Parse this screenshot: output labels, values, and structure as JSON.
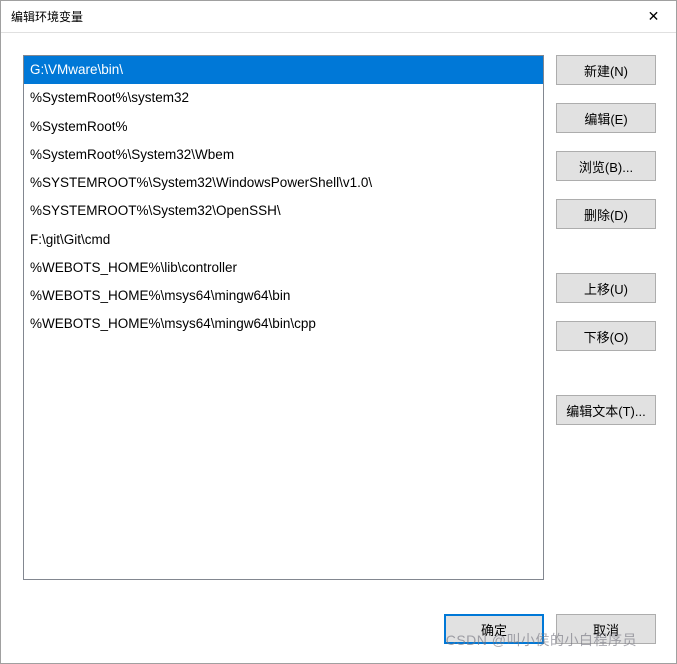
{
  "window": {
    "title": "编辑环境变量",
    "close": "✕"
  },
  "list": {
    "items": [
      "G:\\VMware\\bin\\",
      "%SystemRoot%\\system32",
      "%SystemRoot%",
      "%SystemRoot%\\System32\\Wbem",
      "%SYSTEMROOT%\\System32\\WindowsPowerShell\\v1.0\\",
      "%SYSTEMROOT%\\System32\\OpenSSH\\",
      "F:\\git\\Git\\cmd",
      "%WEBOTS_HOME%\\lib\\controller",
      "%WEBOTS_HOME%\\msys64\\mingw64\\bin",
      "%WEBOTS_HOME%\\msys64\\mingw64\\bin\\cpp"
    ],
    "selected_index": 0
  },
  "buttons": {
    "new": "新建(N)",
    "edit": "编辑(E)",
    "browse": "浏览(B)...",
    "delete": "删除(D)",
    "move_up": "上移(U)",
    "move_down": "下移(O)",
    "edit_text": "编辑文本(T)...",
    "ok": "确定",
    "cancel": "取消"
  },
  "watermark": "CSDN @叫小侯的小白程序员"
}
